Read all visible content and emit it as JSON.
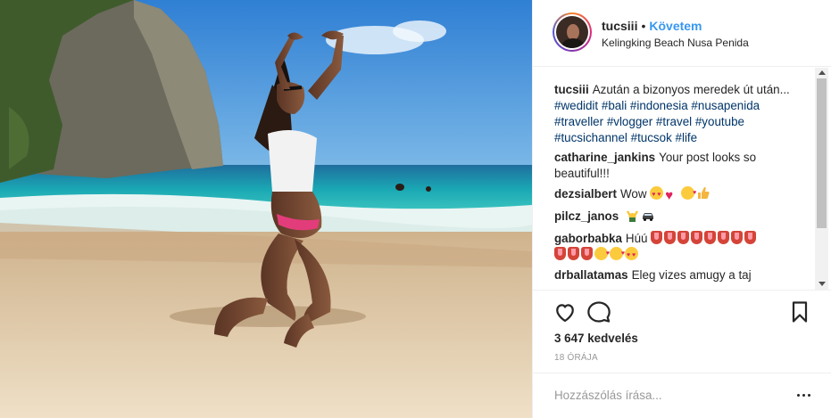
{
  "post": {
    "username": "tucsiii",
    "separator": "•",
    "follow_label": "Követem",
    "location": "Kelingking Beach Nusa Penida"
  },
  "comments": [
    {
      "user": "tucsiii",
      "text": "Azután a bizonyos meredek út után...",
      "tags": [
        "#wedidit",
        "#bali",
        "#indonesia",
        "#nusapenida",
        "#traveller",
        "#vlogger",
        "#travel",
        "#youtube",
        "#tucsichannel",
        "#tucsok",
        "#life"
      ]
    },
    {
      "user": "catharine_jankins",
      "text": "Your post looks so beautiful!!!"
    },
    {
      "user": "dezsialbert",
      "text": "Wow",
      "emoji": [
        "heart-eyes",
        "heart",
        "kiss",
        "thumbs-up"
      ]
    },
    {
      "user": "pilcz_janos",
      "text": "",
      "emoji": [
        "raising-hands",
        "car"
      ]
    },
    {
      "user": "gaborbabka",
      "text": "Húú",
      "emoji": [
        "tongue",
        "tongue",
        "tongue",
        "tongue",
        "tongue",
        "tongue",
        "tongue",
        "tongue",
        "tongue",
        "tongue",
        "tongue",
        "kiss",
        "kiss",
        "heart-eyes"
      ]
    },
    {
      "user": "drballatamas",
      "text": "Eleg vizes amugy a taj"
    }
  ],
  "actions": {
    "like_icon": "heart-outline-icon",
    "comment_icon": "comment-bubble-icon",
    "save_icon": "bookmark-icon"
  },
  "likes": "3 647 kedvelés",
  "timestamp": "18 ÓRÁJA",
  "add_comment": {
    "placeholder": "Hozzászólás írása...",
    "more_icon": "more-options-icon"
  },
  "colors": {
    "link": "#3897f0",
    "hashtag": "#003569",
    "text": "#262626",
    "muted": "#999999",
    "divider": "#efefef"
  }
}
